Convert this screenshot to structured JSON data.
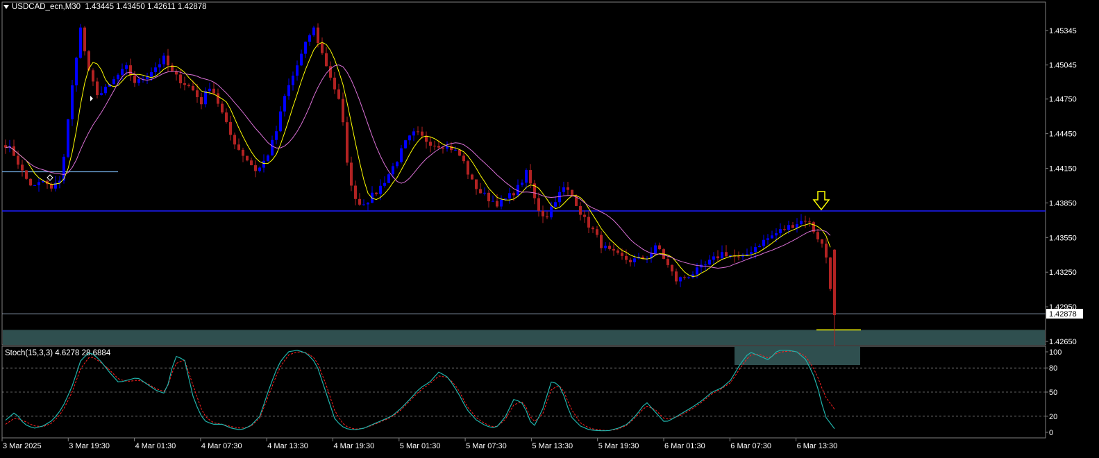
{
  "header": {
    "symbol": "USDCAD_ecn,M30",
    "open": "1.43445",
    "high": "1.43450",
    "low": "1.42611",
    "close": "1.42878"
  },
  "stoch_header": {
    "name": "Stoch(15,3,3)",
    "k": "4.6278",
    "d": "28.6884"
  },
  "colors": {
    "background": "#000000",
    "bull": "#0000ff",
    "bear": "#b22222",
    "fast_ma": "#ffff00",
    "slow_ma": "#da70d6",
    "hline": "#1e1eff",
    "stoch_main": "#20b2aa",
    "stoch_signal": "#ff2020",
    "zone": "#2f4f4f",
    "arrow": "#ffff00"
  },
  "chart_data": [
    {
      "type": "candlestick",
      "price_axis_ticks": [
        "1.45345",
        "1.45045",
        "1.44750",
        "1.44450",
        "1.44150",
        "1.43850",
        "1.43550",
        "1.43250",
        "1.42950",
        "1.42650"
      ],
      "time_axis_ticks": [
        "3 Mar 2025",
        "3 Mar 19:30",
        "4 Mar 01:30",
        "4 Mar 07:30",
        "4 Mar 13:30",
        "4 Mar 19:30",
        "5 Mar 01:30",
        "5 Mar 07:30",
        "5 Mar 13:30",
        "5 Mar 19:30",
        "6 Mar 01:30",
        "6 Mar 07:30",
        "6 Mar 13:30"
      ],
      "ylim": [
        1.4262,
        1.4559
      ],
      "current_price_label": "1.42878",
      "horizontal_lines": [
        1.4378,
        1.4289,
        1.4412
      ],
      "zone": [
        1.4262,
        1.4275
      ],
      "close_anchors": [
        1.4436,
        1.4426,
        1.4408,
        1.4398,
        1.4404,
        1.4396,
        1.4408,
        1.4476,
        1.4538,
        1.4495,
        1.4478,
        1.4485,
        1.4495,
        1.4502,
        1.4488,
        1.4495,
        1.4502,
        1.451,
        1.4496,
        1.449,
        1.4484,
        1.4472,
        1.4488,
        1.4468,
        1.4446,
        1.4432,
        1.4422,
        1.4412,
        1.4424,
        1.4445,
        1.4478,
        1.4498,
        1.4518,
        1.4538,
        1.4514,
        1.4492,
        1.4468,
        1.44,
        1.4384,
        1.4388,
        1.4396,
        1.4408,
        1.4422,
        1.4438,
        1.4446,
        1.444,
        1.4436,
        1.4435,
        1.4432,
        1.4424,
        1.4404,
        1.4394,
        1.4388,
        1.4384,
        1.439,
        1.4398,
        1.4412,
        1.4382,
        1.4372,
        1.4388,
        1.4398,
        1.439,
        1.4372,
        1.4362,
        1.4348,
        1.4342,
        1.4338,
        1.4335,
        1.4336,
        1.4339,
        1.4348,
        1.4332,
        1.4318,
        1.4321,
        1.4325,
        1.433,
        1.4336,
        1.4342,
        1.4339,
        1.4336,
        1.4344,
        1.435,
        1.4355,
        1.436,
        1.4364,
        1.4368,
        1.4371,
        1.4358,
        1.4344,
        1.4288
      ],
      "series": [
        {
          "name": "MA fast",
          "color": "#ffff00"
        },
        {
          "name": "MA slow",
          "color": "#da70d6"
        }
      ]
    },
    {
      "type": "line",
      "title": "Stoch(15,3,3)",
      "ylim": [
        0,
        100
      ],
      "levels": [
        80,
        50,
        20
      ],
      "y_axis_ticks": [
        "100",
        "80",
        "50",
        "20",
        "0"
      ],
      "k_anchors": [
        15,
        25,
        10,
        5,
        8,
        15,
        30,
        55,
        90,
        100,
        90,
        75,
        62,
        65,
        68,
        60,
        52,
        48,
        95,
        90,
        40,
        15,
        10,
        10,
        5,
        3,
        8,
        20,
        55,
        85,
        100,
        102,
        98,
        85,
        50,
        15,
        5,
        3,
        5,
        10,
        15,
        20,
        30,
        42,
        55,
        62,
        75,
        68,
        50,
        28,
        15,
        8,
        5,
        18,
        42,
        35,
        5,
        28,
        65,
        55,
        20,
        8,
        3,
        2,
        2,
        5,
        10,
        22,
        38,
        25,
        12,
        18,
        25,
        32,
        40,
        50,
        55,
        65,
        85,
        100,
        95,
        90,
        102,
        102,
        100,
        90,
        65,
        20,
        4.6
      ],
      "d_anchors": [
        10,
        18,
        14,
        8,
        7,
        12,
        25,
        48,
        80,
        95,
        88,
        78,
        66,
        63,
        65,
        61,
        54,
        50,
        85,
        90,
        55,
        22,
        12,
        10,
        7,
        5,
        7,
        18,
        48,
        78,
        96,
        100,
        99,
        90,
        60,
        25,
        8,
        4,
        5,
        9,
        14,
        19,
        28,
        40,
        52,
        60,
        70,
        68,
        55,
        32,
        18,
        10,
        6,
        15,
        35,
        38,
        12,
        22,
        55,
        58,
        30,
        12,
        5,
        3,
        2,
        4,
        9,
        20,
        33,
        28,
        16,
        18,
        23,
        30,
        38,
        48,
        54,
        62,
        80,
        96,
        97,
        92,
        99,
        101,
        100,
        94,
        75,
        45,
        28.7
      ]
    }
  ]
}
